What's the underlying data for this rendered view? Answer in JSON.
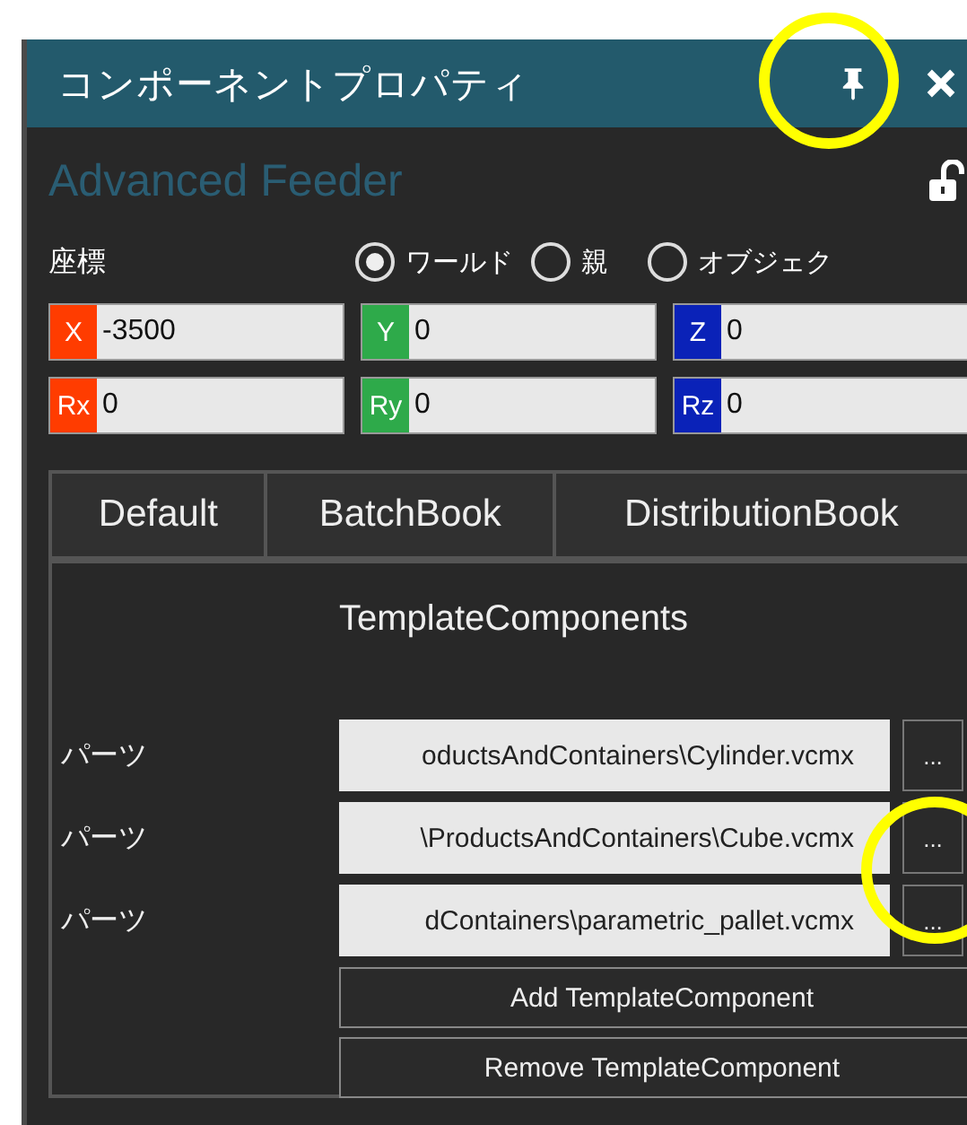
{
  "window": {
    "title": "コンポーネントプロパティ"
  },
  "component_name": "Advanced Feeder",
  "locked": false,
  "coordinates": {
    "label": "座標",
    "options": [
      {
        "label": "ワールド",
        "selected": true
      },
      {
        "label": "親",
        "selected": false
      },
      {
        "label": "オブジェク",
        "selected": false
      }
    ]
  },
  "position_fields": [
    {
      "axis": "X",
      "color": "#ff3c00",
      "value": "-3500"
    },
    {
      "axis": "Y",
      "color": "#2eaa4a",
      "value": "0"
    },
    {
      "axis": "Z",
      "color": "#0a22b8",
      "value": "0"
    },
    {
      "axis": "Rx",
      "color": "#ff3c00",
      "value": "0"
    },
    {
      "axis": "Ry",
      "color": "#2eaa4a",
      "value": "0"
    },
    {
      "axis": "Rz",
      "color": "#0a22b8",
      "value": "0"
    }
  ],
  "tabs": [
    {
      "label": "Default",
      "selected": false
    },
    {
      "label": "BatchBook",
      "selected": false
    },
    {
      "label": "DistributionBook",
      "selected": false
    }
  ],
  "section": {
    "title": "TemplateComponents",
    "parts": [
      {
        "label": "パーツ",
        "value": "oductsAndContainers\\Cylinder.vcmx",
        "button": "..."
      },
      {
        "label": "パーツ",
        "value": "\\ProductsAndContainers\\Cube.vcmx",
        "button": "..."
      },
      {
        "label": "パーツ",
        "value": "dContainers\\parametric_pallet.vcmx",
        "button": "..."
      }
    ],
    "buttons": [
      "Add TemplateComponent",
      "Remove TemplateComponent"
    ]
  }
}
